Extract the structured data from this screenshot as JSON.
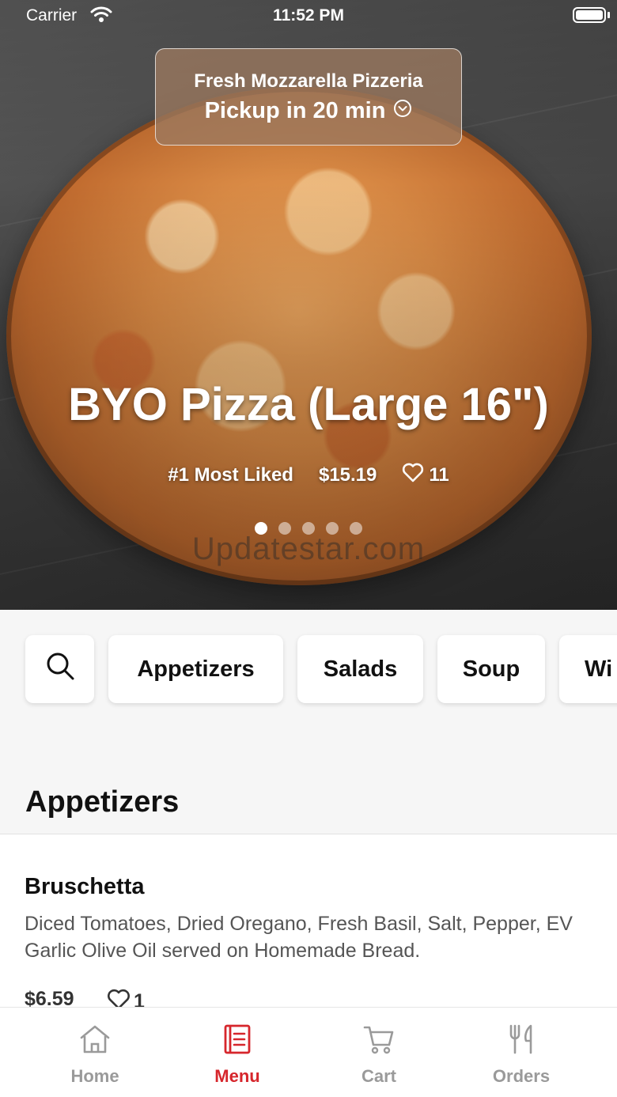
{
  "status_bar": {
    "carrier": "Carrier",
    "time": "11:52 PM"
  },
  "pickup": {
    "restaurant": "Fresh Mozzarella Pizzeria",
    "eta": "Pickup in 20 min"
  },
  "hero": {
    "title": "BYO Pizza (Large 16\")",
    "badge": "#1 Most Liked",
    "price": "$15.19",
    "likes": "11",
    "slide_count": 5,
    "active_slide": 1,
    "watermark": "Updatestar.com"
  },
  "categories": {
    "search_icon": "search-icon",
    "chips": [
      "Appetizers",
      "Salads",
      "Soup",
      "Wi"
    ]
  },
  "menu": {
    "section_title": "Appetizers",
    "items": [
      {
        "name": "Bruschetta",
        "description": "Diced Tomatoes, Dried Oregano, Fresh Basil, Salt, Pepper, EV Garlic Olive Oil served on Homemade Bread.",
        "price": "$6.59",
        "likes": "1"
      }
    ]
  },
  "tabbar": {
    "accent_color": "#d6262c",
    "inactive_color": "#9a9a9a",
    "tabs": [
      {
        "label": "Home",
        "icon": "home-icon"
      },
      {
        "label": "Menu",
        "icon": "menu-icon",
        "active": true
      },
      {
        "label": "Cart",
        "icon": "cart-icon"
      },
      {
        "label": "Orders",
        "icon": "fork-knife-icon"
      }
    ]
  }
}
